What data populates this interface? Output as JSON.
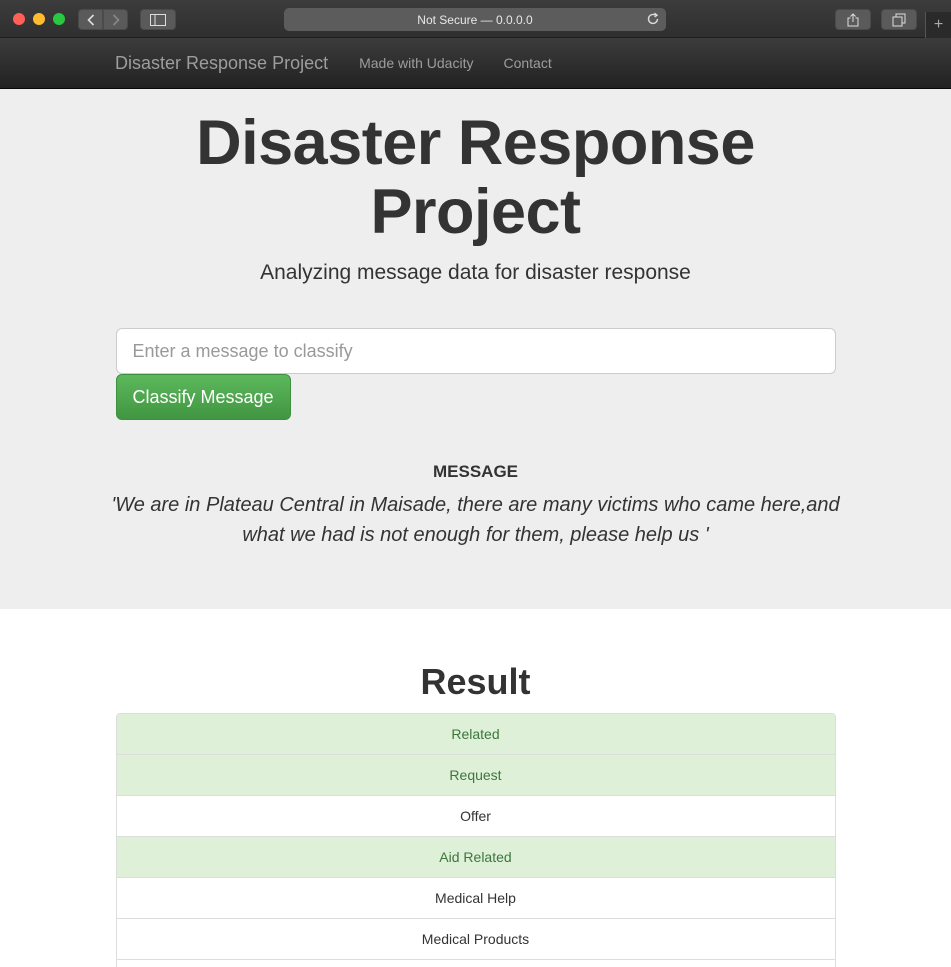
{
  "browser": {
    "address": "Not Secure — 0.0.0.0"
  },
  "navbar": {
    "brand": "Disaster Response Project",
    "links": [
      "Made with Udacity",
      "Contact"
    ]
  },
  "hero": {
    "title_line1": "Disaster Response",
    "title_line2": "Project",
    "subtitle": "Analyzing message data for disaster response"
  },
  "form": {
    "placeholder": "Enter a message to classify",
    "button_label": "Classify Message"
  },
  "message": {
    "heading": "MESSAGE",
    "text": "'We are in Plateau Central in Maisade, there are many victims who came here,and what we had is not enough for them, please help us '"
  },
  "result": {
    "heading": "Result",
    "categories": [
      {
        "label": "Related",
        "positive": true
      },
      {
        "label": "Request",
        "positive": true
      },
      {
        "label": "Offer",
        "positive": false
      },
      {
        "label": "Aid Related",
        "positive": true
      },
      {
        "label": "Medical Help",
        "positive": false
      },
      {
        "label": "Medical Products",
        "positive": false
      },
      {
        "label": "",
        "positive": false
      }
    ]
  },
  "colors": {
    "positive_bg": "#dff0d8",
    "positive_text": "#3c763d",
    "button_green": "#5cb85c"
  }
}
